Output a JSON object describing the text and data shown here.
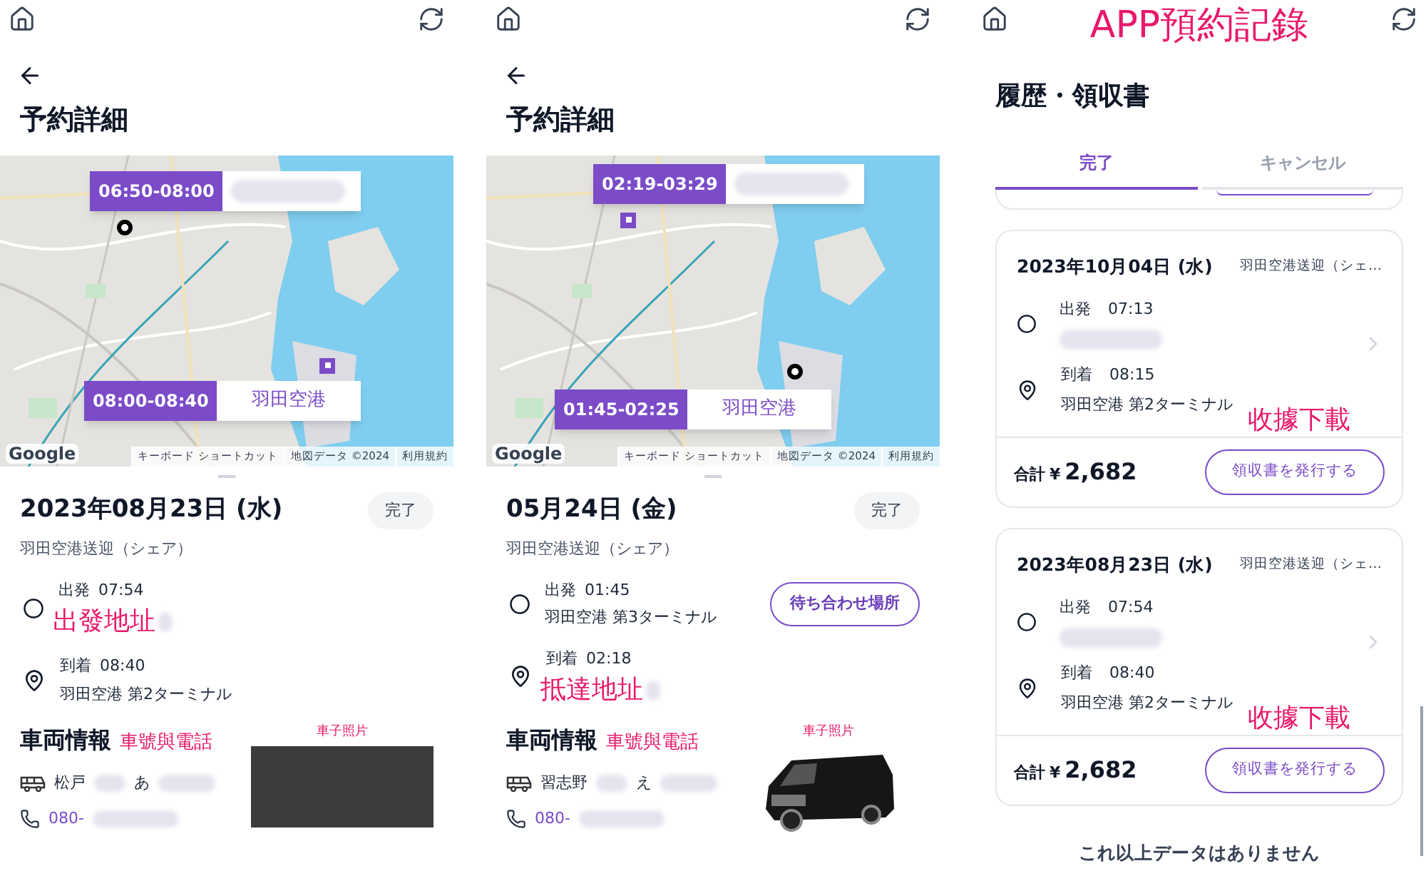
{
  "detail_screens": [
    {
      "title": "予約詳細",
      "map": {
        "pickup_callout": {
          "time": "06:50-08:00"
        },
        "dropoff_callout": {
          "time": "08:00-08:40",
          "place": "羽田空港"
        },
        "google_logo": "Google",
        "attribution": [
          "キーボード ショートカット",
          "地図データ ©2024",
          "利用規約"
        ]
      },
      "date": "2023年08月23日 (水)",
      "status": "完了",
      "service": "羽田空港送迎（シェア）",
      "departure": {
        "label": "出発",
        "time": "07:54",
        "annotation": "出發地址"
      },
      "arrival": {
        "label": "到着",
        "time": "08:40",
        "address": "羽田空港 第2ターミナル"
      },
      "vehicle": {
        "heading": "車両情報",
        "annotation": "車號與電話",
        "plate_parts": [
          "松戸",
          "あ"
        ],
        "phone": "080-",
        "photo": {
          "caption": "車子照片",
          "kind": "photo"
        }
      }
    },
    {
      "title": "予約詳細",
      "map": {
        "pickup_callout": {
          "time": "02:19-03:29"
        },
        "dropoff_callout": {
          "time": "01:45-02:25",
          "place": "羽田空港"
        },
        "google_logo": "Google",
        "attribution": [
          "キーボード ショートカット",
          "地図データ ©2024",
          "利用規約"
        ]
      },
      "date": "05月24日 (金)",
      "status": "完了",
      "service": "羽田空港送迎（シェア）",
      "departure": {
        "label": "出発",
        "time": "01:45",
        "address": "羽田空港 第3ターミナル"
      },
      "meet_button": "待ち合わせ場所",
      "arrival": {
        "label": "到着",
        "time": "02:18",
        "annotation": "抵達地址"
      },
      "vehicle": {
        "heading": "車両情報",
        "annotation": "車號與電話",
        "plate_parts": [
          "習志野",
          "え"
        ],
        "phone": "080-",
        "photo": {
          "caption": "車子照片",
          "kind": "cutout"
        }
      }
    }
  ],
  "history_screen": {
    "annotation": "APP預約記錄",
    "title": "履歴・領収書",
    "tabs": [
      {
        "label": "完了",
        "selected": true
      },
      {
        "label": "キャンセル",
        "selected": false
      }
    ],
    "cards": [
      {
        "date": "2023年10月04日 (水)",
        "service": "羽田空港送迎（シェ…",
        "departure": {
          "label": "出発",
          "time": "07:13"
        },
        "arrival": {
          "label": "到着",
          "time": "08:15",
          "address": "羽田空港 第2ターミナル"
        },
        "total_label": "合計",
        "currency": "¥",
        "amount": "2,682",
        "receipt_button": "領収書を発行する",
        "annotation": "收據下載"
      },
      {
        "date": "2023年08月23日 (水)",
        "service": "羽田空港送迎（シェ…",
        "departure": {
          "label": "出発",
          "time": "07:54"
        },
        "arrival": {
          "label": "到着",
          "time": "08:40",
          "address": "羽田空港 第2ターミナル"
        },
        "total_label": "合計",
        "currency": "¥",
        "amount": "2,682",
        "receipt_button": "領収書を発行する",
        "annotation": "收據下載"
      }
    ],
    "end_text": "これ以上データはありません"
  }
}
